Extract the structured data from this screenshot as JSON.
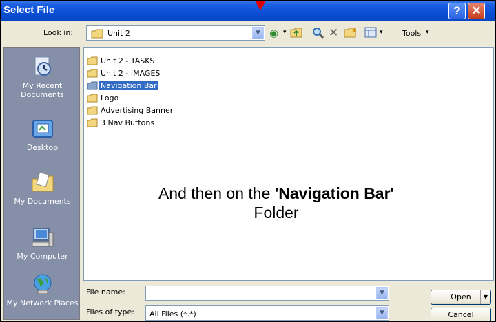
{
  "window": {
    "title": "Select File"
  },
  "toolbar": {
    "look_in_label": "Look in:",
    "look_in_value": "Unit 2",
    "tools_label": "Tools",
    "icons": [
      "back-icon",
      "up-folder-icon",
      "search-web-icon",
      "delete-icon",
      "new-folder-icon",
      "views-icon"
    ]
  },
  "places": [
    {
      "label": "My Recent Documents",
      "icon": "recent-documents-icon"
    },
    {
      "label": "Desktop",
      "icon": "desktop-icon"
    },
    {
      "label": "My Documents",
      "icon": "my-documents-icon"
    },
    {
      "label": "My Computer",
      "icon": "my-computer-icon"
    },
    {
      "label": "My Network Places",
      "icon": "network-places-icon"
    }
  ],
  "files": [
    {
      "name": "Unit 2 - TASKS",
      "selected": false
    },
    {
      "name": "Unit 2 - IMAGES",
      "selected": false
    },
    {
      "name": "Navigation Bar",
      "selected": true
    },
    {
      "name": "Logo",
      "selected": false
    },
    {
      "name": "Advertising Banner",
      "selected": false
    },
    {
      "name": "3 Nav Buttons",
      "selected": false
    }
  ],
  "overlay": {
    "line1_prefix": "And then on the ",
    "line1_bold": "'Navigation Bar'",
    "line2": "Folder"
  },
  "bottom": {
    "file_name_label": "File name:",
    "file_name_value": "",
    "file_type_label": "Files of type:",
    "file_type_value": "All Files (*.*)",
    "open_label": "Open",
    "cancel_label": "Cancel"
  },
  "colors": {
    "title_bar": "#0a4fd6",
    "selection": "#316ac5",
    "places_bar": "#8590a8",
    "annotation_arrow": "#e00000"
  }
}
